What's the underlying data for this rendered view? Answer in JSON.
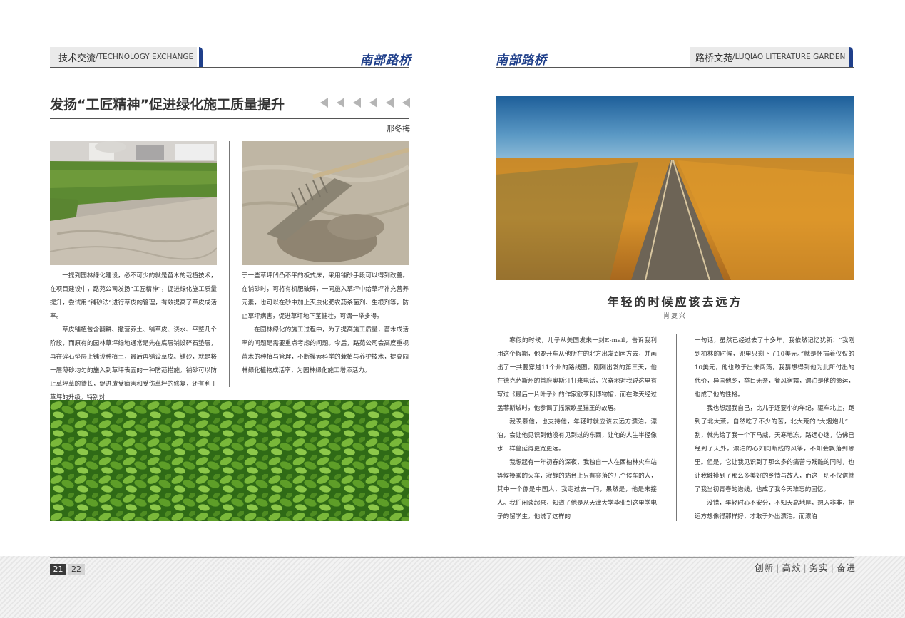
{
  "left": {
    "section": {
      "cn": "技术交流",
      "sep": " / ",
      "en": "TECHNOLOGY EXCHANGE"
    },
    "brand": "南部路桥",
    "article": {
      "title": "发扬“工匠精神”促进绿化施工质量提升",
      "author": "邢冬梅",
      "col1": [
        "一提到园林绿化建设，必不可少的就是苗木的栽植技术，在项目建设中，路苑公司发扬“工匠精神”，促进绿化施工质量提升，尝试用“铺砂法”进行草皮的管理，有效提高了草皮成活率。",
        "草皮铺植包含翻耕、撒营养土、铺草皮、浇水、平整几个阶段，而原有的园林草坪绿地通常是先在底层铺设碎石垫层，再在碎石垫层上铺设种植土，最后再铺设草皮。铺砂，就是将一层薄砂均匀的施入到草坪表面的一种防范措施。铺砂可以防止草坪草的徒长，促进遭受病害和受伤草坪的修复，还有利于草坪的升级。特别对"
      ],
      "col2": [
        "于一些草坪凹凸不平的板式床，采用铺砂手段可以得到改善。在铺砂时，可将有机肥破碎，一同施入草坪中给草坪补充营养元素，也可以在砂中加上灭虫化肥农药杀菌剂、生根剂等，防止草坪病害，促进草坪地下茎健壮，可谓一举多得。",
        "在园林绿化的施工过程中，为了提高施工质量，苗木成活率的问题是需要重点考虑的问题。今后，路苑公司会高度重视苗木的种植与管理，不断摸索科学的栽植与养护技术，提高园林绿化植物成活率，为园林绿化施工增添活力。"
      ]
    }
  },
  "right": {
    "brand": "南部路桥",
    "section": {
      "cn": "路桥文苑",
      "sep": " / ",
      "en": "LUQIAO  LITERATURE GARDEN"
    },
    "article": {
      "title": "年轻的时候应该去远方",
      "author": "肖复兴",
      "col1": [
        "寒假的时候，儿子从美国发来一封E-mail，告诉我利用这个假期，他要开车从他所在的北方出发到南方去，并画出了一共要穿越11个州的路线图。刚刚出发的第三天，他在德克萨斯州的首府奥斯汀打来电话，兴奋地对我说这里有写过《最后一片叶子》的作家欧亨利博物馆，而在昨天经过孟菲斯城时，他参谒了摇滚歌星猫王的故居。",
        "我羡慕他，也支持他，年轻时就应该去远方漂泊。漂泊，会让他见识到他没有见到过的东西，让他的人生半径像水一样蔓延得更宽更远。",
        "我想起有一年初春的深夜，我独自一人在西柏林火车站等候换乘的火车，寂静的站台上只有寥落的几个候车的人，其中一个像是中国人，我走过去一问，果然是，他是来接人。我们闲谈起来，知道了他是从天津大学毕业到这里学电子的留学生。他说了这样的"
      ],
      "col2": [
        "一句话，虽然已经过去了十多年，我依然记忆犹新：“我刚到柏林的时候，兜里只剩下了10美元。”就是怀揣着仅仅的10美元，他也敢于出来闯荡，我猜想得到他为此所付出的代价，异国他乡，举目无亲，餐风宿露，漂泊是他的命运，也成了他的性格。",
        "我也想起我自己，比儿子还要小的年纪，驱车北上，跑到了北大荒。自然吃了不少的苦，北大荒的“大烟炮儿”一刮，就先给了我一个下马威，天寒地冻，路远心迷，仿佛已经到了天外，漂泊的心如同断线的风筝，不知会飘落到哪里。但是，它让我见识到了那么多的痛苦与残酷的同时，也让我触摸到了那么多美好的乡情与故人，而这一切不仅谱就了我当初青春的谱线，也成了我今天难忘的回忆。",
        "没错，年轻时心不安分，不知天高地厚，想入非非，把远方想像得那样好，才敢于外出漂泊。而漂泊"
      ]
    }
  },
  "footer": {
    "page_left": "21",
    "page_right": "22",
    "slogan": [
      "创新",
      "高效",
      "务实",
      "奋进"
    ],
    "slogan_sep": "|"
  }
}
